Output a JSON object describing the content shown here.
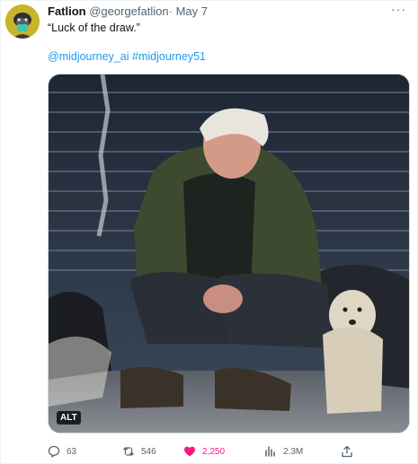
{
  "tweet": {
    "author": {
      "display_name": "Fatlion",
      "handle": "@georgefatlion",
      "avatar_icon": "avatar-icon"
    },
    "separator": "·",
    "date": "May 7",
    "more_icon": "more-icon",
    "more_glyph": "···",
    "text": "“Luck of the draw.”",
    "mentions": [
      "@midjourney_ai",
      "#midjourney51"
    ],
    "media": {
      "alt_badge": "ALT"
    },
    "metrics": {
      "replies": "63",
      "retweets": "546",
      "likes": "2,250",
      "views": "2.3M"
    },
    "colors": {
      "link": "#1d9bf0",
      "like": "#f91880",
      "muted": "#536471"
    }
  }
}
